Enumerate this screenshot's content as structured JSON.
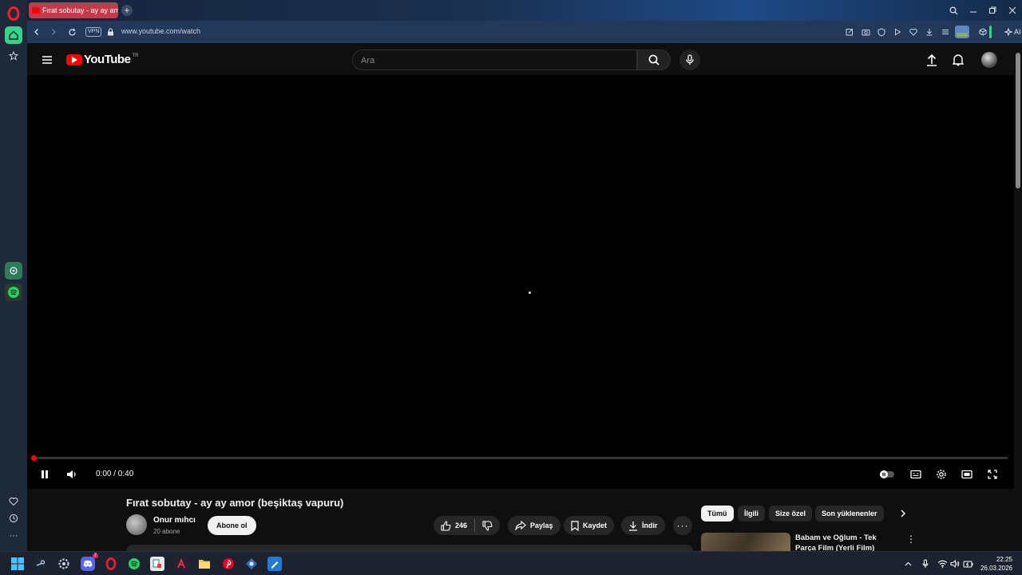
{
  "browser": {
    "tab_title": "Fırat sobutay - ay ay amor",
    "new_tab_label": "+",
    "vpn_label": "VPN",
    "url": "www.youtube.com/watch",
    "ai_label": "AI"
  },
  "youtube": {
    "logo_text": "YouTube",
    "country_code": "TR",
    "search_placeholder": "Ara",
    "player": {
      "time_display": "0:00 / 0:40",
      "progress_fraction": 0.0,
      "state": "playing"
    },
    "video": {
      "title": "Fırat sobutay - ay ay amor (beşiktaş vapuru)",
      "channel_name": "Onur mıhcı",
      "subscribers": "20 abone",
      "subscribe_label": "Abone ol",
      "like_count": "246",
      "share_label": "Paylaş",
      "save_label": "Kaydet",
      "download_label": "İndir",
      "more_label": "···"
    },
    "chips": [
      {
        "label": "Tümü",
        "active": true
      },
      {
        "label": "İlgili",
        "active": false
      },
      {
        "label": "Size özel",
        "active": false
      },
      {
        "label": "Son yüklenenler",
        "active": false
      }
    ],
    "recommendation": {
      "title": "Babam ve Oğlum - Tek Parça Film (Yerli Film) (Yönetmen:",
      "menu_label": "⋮"
    }
  },
  "taskbar": {
    "time": "22:25",
    "date": "26.03.2026",
    "discord_badge": "7"
  },
  "colors": {
    "opera_red": "#ff1b2d",
    "youtube_red": "#ff0000",
    "opera_home_green": "#36d38c",
    "spotify_green": "#1ed760"
  }
}
